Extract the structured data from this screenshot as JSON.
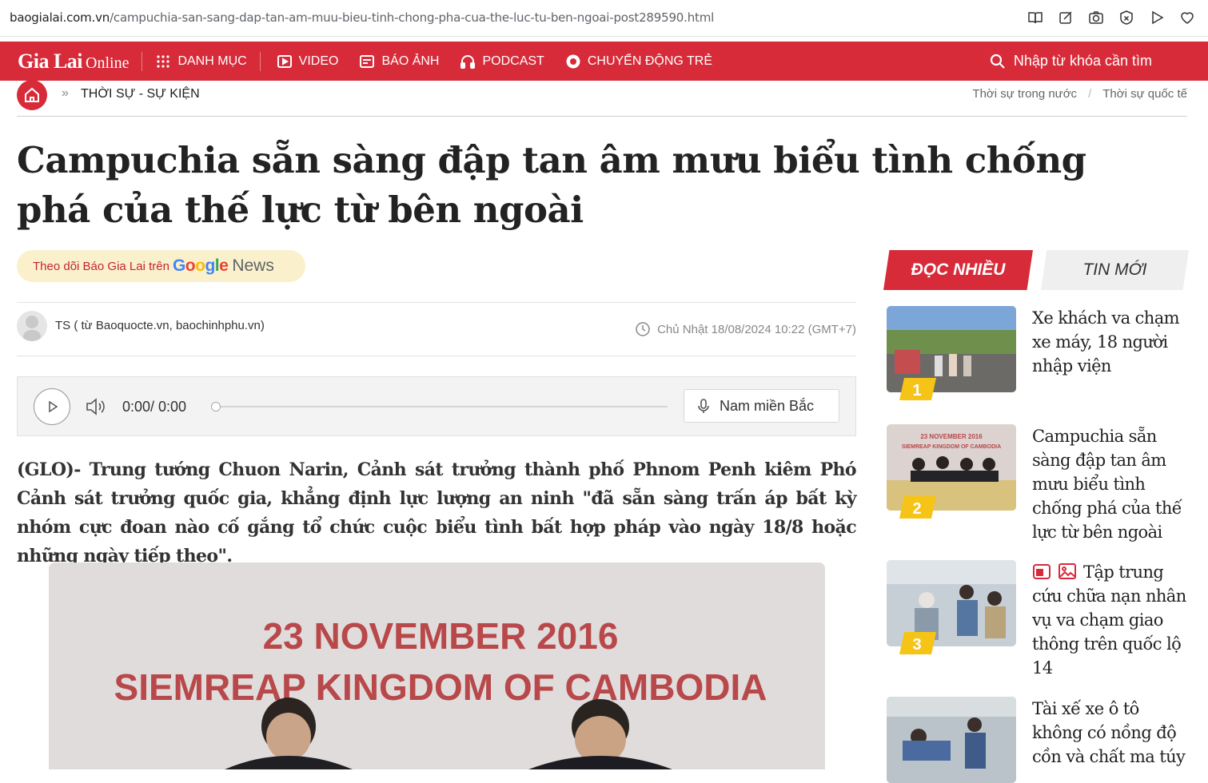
{
  "browser": {
    "url_host": "baogialai.com.vn",
    "url_path": "/campuchia-san-sang-dap-tan-am-muu-bieu-tinh-chong-pha-cua-the-luc-tu-ben-ngoai-post289590.html",
    "icons": [
      "reader-icon",
      "edit-icon",
      "camera-icon",
      "shield-x-icon",
      "play-icon",
      "heart-icon"
    ]
  },
  "nav": {
    "logo_main": "Gia Lai",
    "logo_sub": "Online",
    "items": [
      {
        "label": "DANH MỤC",
        "icon": "grid-icon"
      },
      {
        "label": "VIDEO",
        "icon": "video-icon"
      },
      {
        "label": "BÁO ẢNH",
        "icon": "photo-icon"
      },
      {
        "label": "PODCAST",
        "icon": "headphones-icon"
      },
      {
        "label": "CHUYỂN ĐỘNG TRẺ",
        "icon": "circle-icon"
      }
    ],
    "search_placeholder": "Nhập từ khóa cần tìm",
    "brand_color": "#d72b3a"
  },
  "breadcrumb": {
    "separator": "»",
    "category": "THỜI SỰ - SỰ KIỆN",
    "links": [
      "Thời sự trong nước",
      "Thời sự quốc tế"
    ],
    "slash": "/"
  },
  "article": {
    "title": "Campuchia sẵn sàng đập tan âm mưu biểu tình chống phá của thế lực từ bên ngoài",
    "follow_text": "Theo dõi Báo Gia Lai trên",
    "google": "Google",
    "news": "News",
    "author": "TS ( từ Baoquocte.vn, baochinhphu.vn)",
    "date": "Chủ Nhật 18/08/2024 10:22 (GMT+7)",
    "lead": "(GLO)- Trung tướng Chuon Narin, Cảnh sát trưởng thành phố Phnom Penh kiêm Phó Cảnh sát trưởng quốc gia, khẳng định lực lượng an ninh \"đã sẵn sàng trấn áp bất kỳ nhóm cực đoan nào cố gắng tổ chức cuộc biểu tình bất hợp pháp vào ngày 18/8 hoặc những ngày tiếp theo\".",
    "image_line1": "23 NOVEMBER 2016",
    "image_line2": "SIEMREAP KINGDOM OF CAMBODIA"
  },
  "player": {
    "time": "0:00/ 0:00",
    "progress": 0,
    "voice": "Nam miền Bắc"
  },
  "sidebar": {
    "tab_active": "ĐỌC NHIỀU",
    "tab_other": "TIN MỚI",
    "items": [
      {
        "rank": "1",
        "title": "Xe khách va chạm xe máy, 18 người nhập viện"
      },
      {
        "rank": "2",
        "title": "Campuchia sẵn sàng đập tan âm mưu biểu tình chống phá của thế lực từ bên ngoài"
      },
      {
        "rank": "3",
        "title": "Tập trung cứu chữa nạn nhân vụ va chạm giao thông trên quốc lộ 14"
      },
      {
        "rank": "",
        "title": "Tài xế xe ô tô không có nồng độ cồn và chất ma túy"
      }
    ]
  }
}
